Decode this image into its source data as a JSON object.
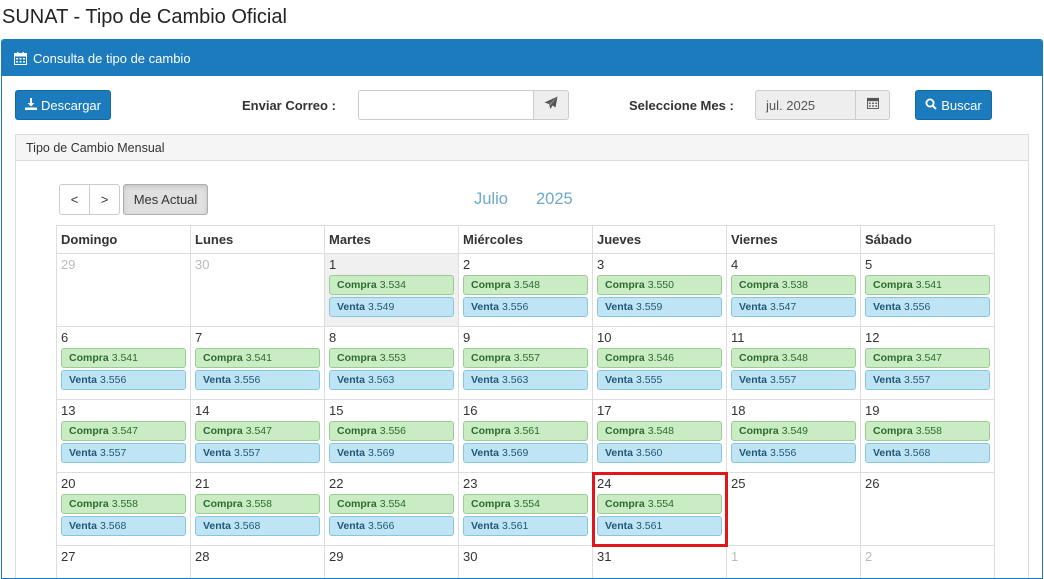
{
  "page_title": "SUNAT - Tipo de Cambio Oficial",
  "panel": {
    "title": "Consulta de tipo de cambio",
    "icon": "calendar-icon"
  },
  "toolbar": {
    "download_label": "Descargar",
    "email_label": "Enviar Correo :",
    "email_value": "",
    "month_label": "Seleccione Mes :",
    "month_value": "jul. 2025",
    "search_label": "Buscar"
  },
  "inner_panel_title": "Tipo de Cambio Mensual",
  "calendar": {
    "prev_label": "<",
    "next_label": ">",
    "current_label": "Mes Actual",
    "month": "Julio",
    "year": "2025",
    "compra_label": "Compra",
    "venta_label": "Venta",
    "weekdays": [
      "Domingo",
      "Lunes",
      "Martes",
      "Miércoles",
      "Jueves",
      "Viernes",
      "Sábado"
    ],
    "weeks": [
      [
        {
          "day": "29",
          "muted": true
        },
        {
          "day": "30",
          "muted": true
        },
        {
          "day": "1",
          "compra": "3.534",
          "venta": "3.549",
          "today": true
        },
        {
          "day": "2",
          "compra": "3.548",
          "venta": "3.556"
        },
        {
          "day": "3",
          "compra": "3.550",
          "venta": "3.559"
        },
        {
          "day": "4",
          "compra": "3.538",
          "venta": "3.547"
        },
        {
          "day": "5",
          "compra": "3.541",
          "venta": "3.556"
        }
      ],
      [
        {
          "day": "6",
          "compra": "3.541",
          "venta": "3.556"
        },
        {
          "day": "7",
          "compra": "3.541",
          "venta": "3.556"
        },
        {
          "day": "8",
          "compra": "3.553",
          "venta": "3.563"
        },
        {
          "day": "9",
          "compra": "3.557",
          "venta": "3.563"
        },
        {
          "day": "10",
          "compra": "3.546",
          "venta": "3.555"
        },
        {
          "day": "11",
          "compra": "3.548",
          "venta": "3.557"
        },
        {
          "day": "12",
          "compra": "3.547",
          "venta": "3.557"
        }
      ],
      [
        {
          "day": "13",
          "compra": "3.547",
          "venta": "3.557"
        },
        {
          "day": "14",
          "compra": "3.547",
          "venta": "3.557"
        },
        {
          "day": "15",
          "compra": "3.556",
          "venta": "3.569"
        },
        {
          "day": "16",
          "compra": "3.561",
          "venta": "3.569"
        },
        {
          "day": "17",
          "compra": "3.548",
          "venta": "3.560"
        },
        {
          "day": "18",
          "compra": "3.549",
          "venta": "3.556"
        },
        {
          "day": "19",
          "compra": "3.558",
          "venta": "3.568"
        }
      ],
      [
        {
          "day": "20",
          "compra": "3.558",
          "venta": "3.568"
        },
        {
          "day": "21",
          "compra": "3.558",
          "venta": "3.568"
        },
        {
          "day": "22",
          "compra": "3.554",
          "venta": "3.566"
        },
        {
          "day": "23",
          "compra": "3.554",
          "venta": "3.561"
        },
        {
          "day": "24",
          "compra": "3.554",
          "venta": "3.561",
          "selected": true
        },
        {
          "day": "25"
        },
        {
          "day": "26"
        }
      ],
      [
        {
          "day": "27"
        },
        {
          "day": "28"
        },
        {
          "day": "29"
        },
        {
          "day": "30"
        },
        {
          "day": "31"
        },
        {
          "day": "1",
          "muted": true
        },
        {
          "day": "2",
          "muted": true
        }
      ]
    ]
  }
}
